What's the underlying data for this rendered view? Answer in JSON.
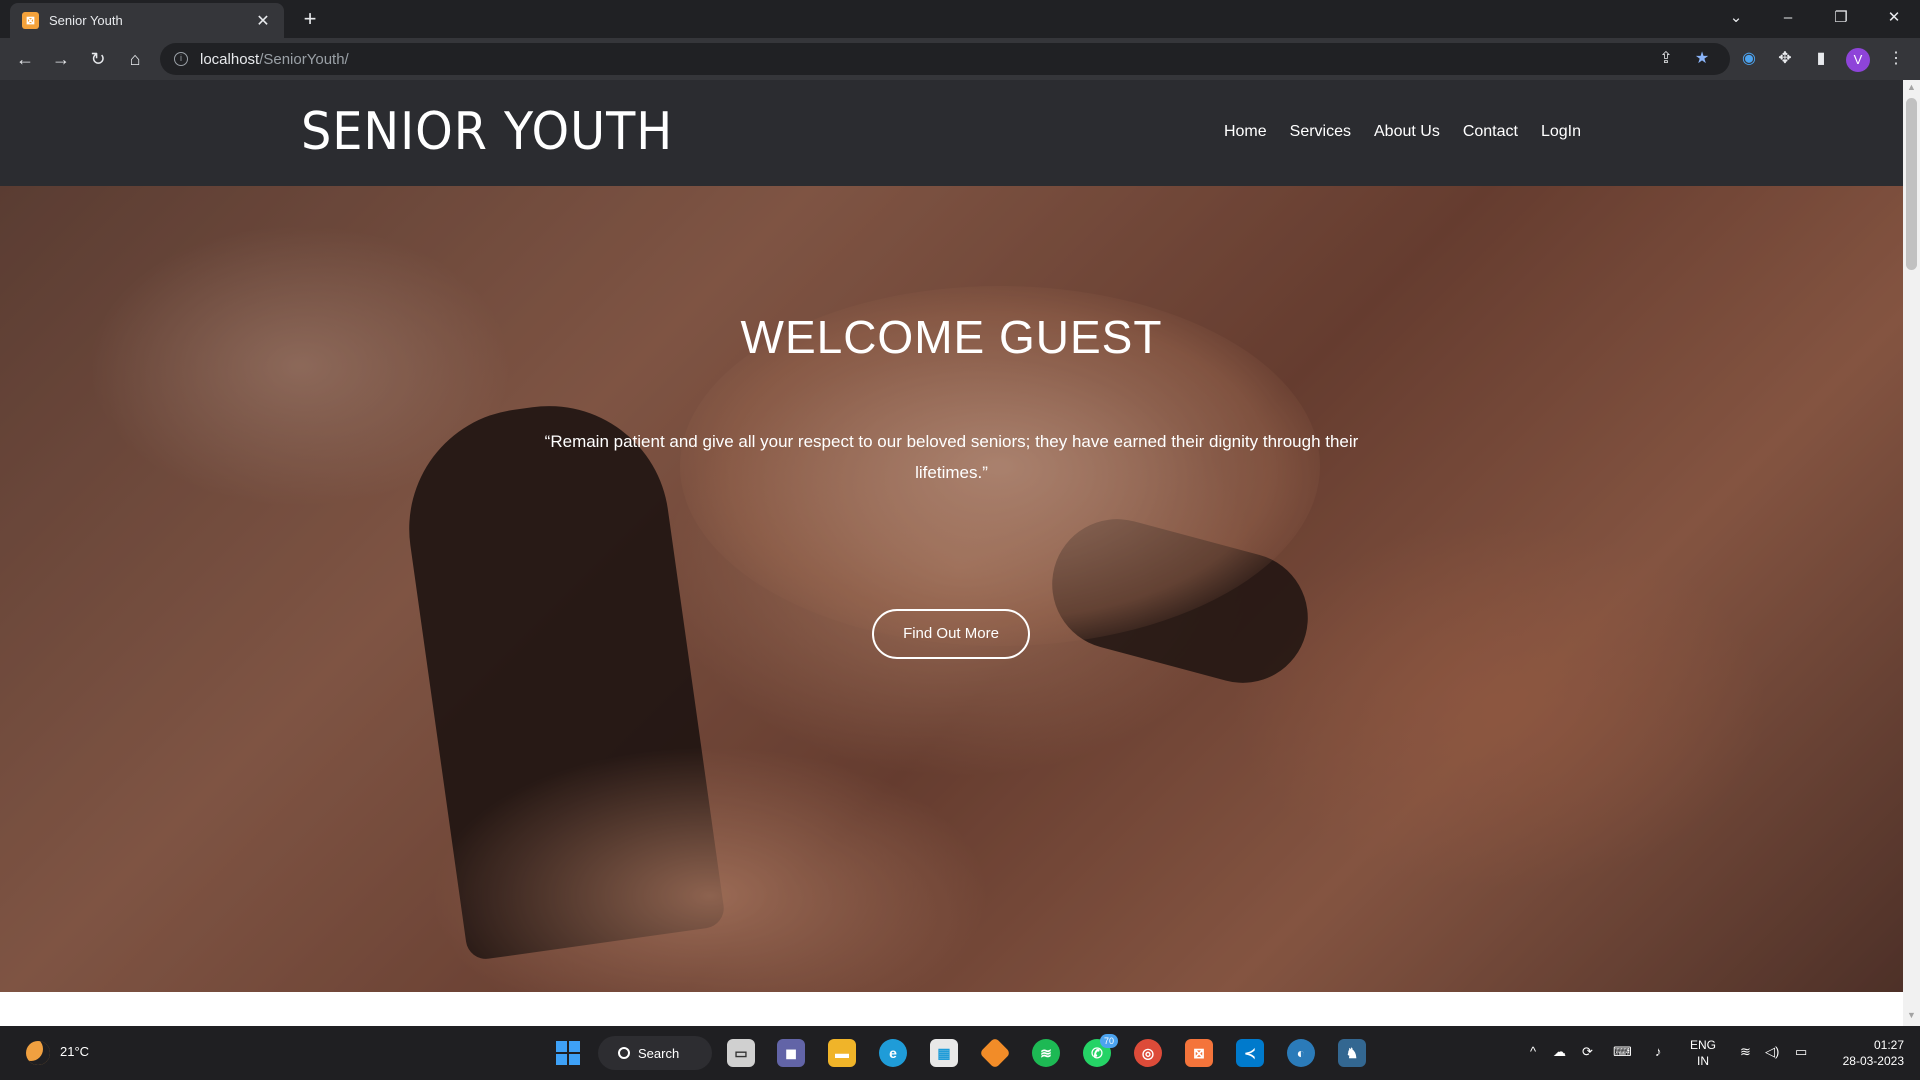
{
  "browser": {
    "tab_title": "Senior Youth",
    "favicon_glyph": "⊠",
    "url_host": "localhost",
    "url_path": "/SeniorYouth/",
    "profile_initial": "V"
  },
  "site": {
    "brand": "SENIOR YOUTH",
    "nav": [
      {
        "label": "Home"
      },
      {
        "label": "Services"
      },
      {
        "label": "About Us"
      },
      {
        "label": "Contact"
      },
      {
        "label": "LogIn"
      }
    ],
    "hero": {
      "title": "WELCOME GUEST",
      "quote": "“Remain patient and give all your respect to our beloved seniors; they have earned their dignity through their lifetimes.”",
      "cta_label": "Find Out More"
    }
  },
  "taskbar": {
    "weather": "21°C",
    "search_label": "Search",
    "whatsapp_badge": "70",
    "lang_line1": "ENG",
    "lang_line2": "IN",
    "time": "01:27",
    "date": "28-03-2023"
  },
  "colors": {
    "nav_bg": "#2b2c30",
    "accent_star": "#8ab4f8",
    "avatar": "#8e44d9"
  }
}
